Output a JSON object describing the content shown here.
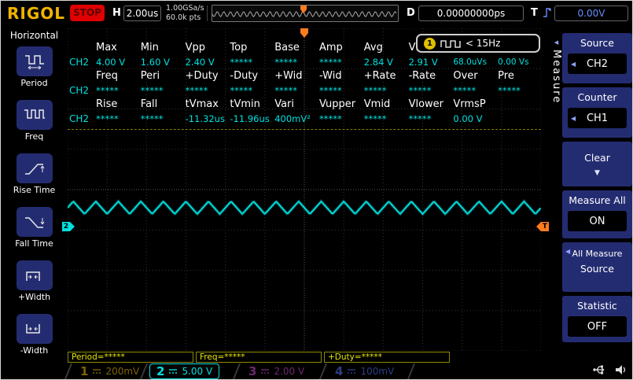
{
  "colors": {
    "ch1": "#c8a000",
    "ch2": "#00e0e0",
    "ch3": "#b43cb4",
    "ch4": "#4862d2",
    "trigger": "#ff7c1e",
    "menu_blue": "#242c71",
    "readout_yellow": "#e8e800"
  },
  "top_bar": {
    "brand": "RIGOL",
    "run_state": "STOP",
    "h_label": "H",
    "timebase": "2.00us",
    "sample_rate": "1.00GSa/s",
    "memory_depth": "60.0k pts",
    "d_label": "D",
    "delay": "0.00000000ps",
    "t_label": "T",
    "trigger_level": "0.00V"
  },
  "left_menu": {
    "title": "Horizontal",
    "items": [
      "Period",
      "Freq",
      "Rise Time",
      "Fall Time",
      "+Width",
      "-Width"
    ]
  },
  "counter": {
    "channel": "1",
    "value": "< 15Hz"
  },
  "measure_table": {
    "channel_label": "CH2",
    "groups": [
      {
        "headers": [
          "Max",
          "Min",
          "Vpp",
          "Top",
          "Base",
          "Amp",
          "Avg",
          "Vrms"
        ],
        "values": [
          "4.00 V",
          "1.60 V",
          "2.40 V",
          "*****",
          "*****",
          "*****",
          "2.84 V",
          "2.91 V",
          "68.0uVs",
          "0.00 Vs"
        ]
      },
      {
        "headers": [
          "Freq",
          "Peri",
          "+Duty",
          "-Duty",
          "+Wid",
          "-Wid",
          "+Rate",
          "-Rate",
          "Over",
          "Pre"
        ],
        "values": [
          "*****",
          "*****",
          "*****",
          "*****",
          "*****",
          "*****",
          "*****",
          "*****",
          "*****",
          "*****"
        ]
      },
      {
        "headers": [
          "Rise",
          "Fall",
          "tVmax",
          "tVmin",
          "Vari",
          "Vupper",
          "Vmid",
          "Vlower",
          "VrmsP"
        ],
        "values": [
          "*****",
          "*****",
          "-11.32us",
          "-11.96us",
          "400mV²",
          "*****",
          "*****",
          "*****",
          "0.00 V"
        ]
      }
    ]
  },
  "right_menu": {
    "tab": "Measure",
    "source": {
      "label": "Source",
      "value": "CH2"
    },
    "counter": {
      "label": "Counter",
      "value": "CH1"
    },
    "clear": {
      "label": "Clear"
    },
    "measure_all": {
      "label": "Measure All",
      "value": "ON"
    },
    "all_measure": {
      "line1": "All Measure",
      "line2": "Source"
    },
    "statistic": {
      "label": "Statistic",
      "value": "OFF"
    }
  },
  "bottom_bar": {
    "readouts": [
      "Period=*****",
      "Freq=*****",
      "+Duty=*****"
    ],
    "channels": [
      {
        "num": "1",
        "scale": "200mV",
        "active": false
      },
      {
        "num": "2",
        "scale": "5.00 V",
        "active": true
      },
      {
        "num": "3",
        "scale": "2.00 V",
        "active": false
      },
      {
        "num": "4",
        "scale": "100mV",
        "active": false
      }
    ]
  },
  "waveform": {
    "channel": "CH2",
    "shape": "triangle",
    "cycles": 21
  },
  "graticule": {
    "h_divs": 12,
    "v_divs": 8
  },
  "icons": {
    "left_arrow": "◀",
    "down_arrow": "▼"
  }
}
